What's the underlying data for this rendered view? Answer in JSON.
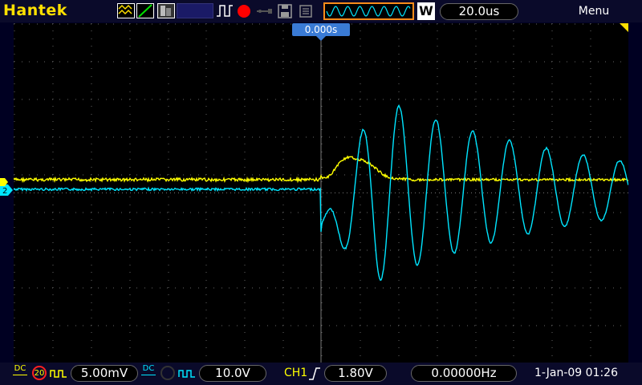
{
  "brand": "Hantek",
  "top": {
    "timebase": "20.0us",
    "menu_label": "Menu",
    "trigger_position": "0.000s",
    "mode_letter": "W"
  },
  "channels": {
    "ch1": {
      "coupling": "DC",
      "bw_limit": "20",
      "volts_div": "5.00mV",
      "color": "#ffff00"
    },
    "ch2": {
      "coupling": "DC",
      "volts_div": "10.0V",
      "color": "#00e5ff"
    }
  },
  "trigger": {
    "source": "CH1",
    "edge": "rising",
    "level": "1.80V"
  },
  "frequency": "0.00000Hz",
  "datetime": "1-Jan-09 01:26",
  "colors": {
    "accent": "#ffe000",
    "ch2": "#00e5ff",
    "ch1": "#ffff00",
    "trigger_marker": "#3a7bd5",
    "run_indicator": "#ff0000"
  }
}
